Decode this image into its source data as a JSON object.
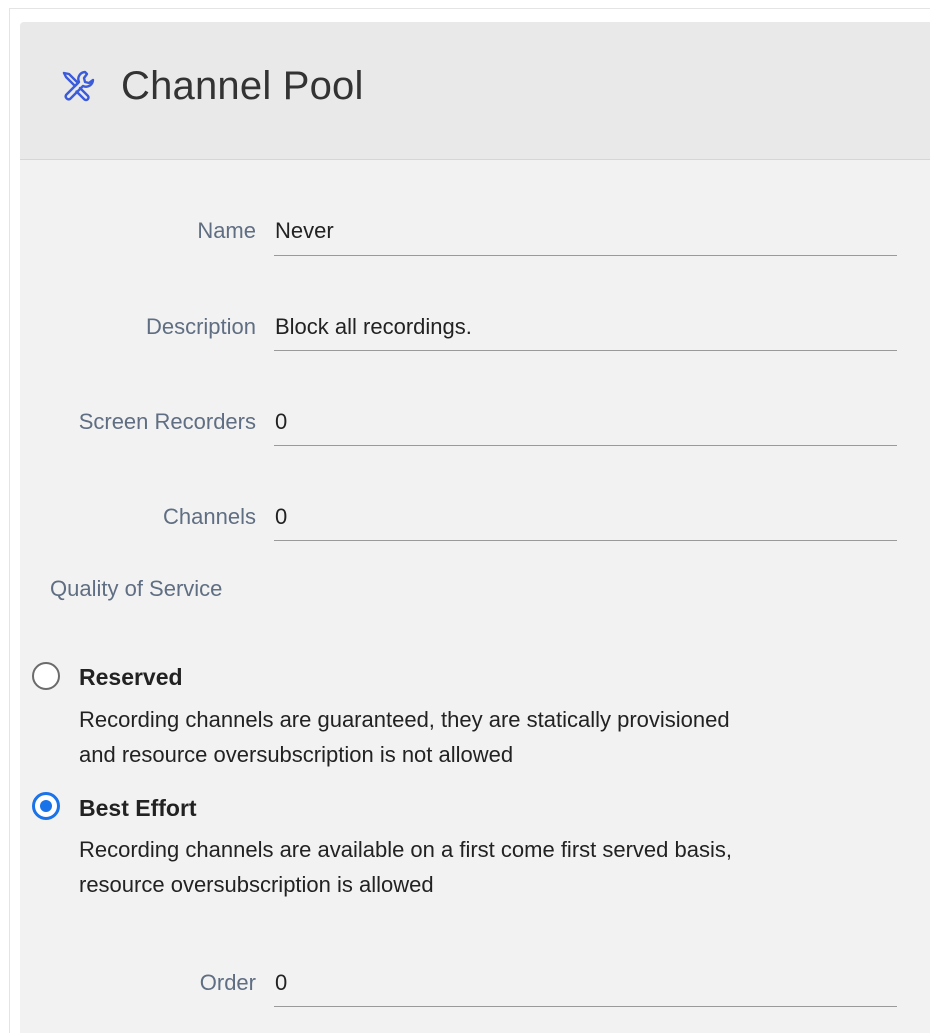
{
  "header": {
    "title": "Channel Pool",
    "icon": "tools-icon",
    "icon_color": "#3b5bdb"
  },
  "fields": {
    "name": {
      "label": "Name",
      "value": "Never"
    },
    "description": {
      "label": "Description",
      "value": "Block all recordings."
    },
    "screen_recorders": {
      "label": "Screen Recorders",
      "value": "0"
    },
    "channels": {
      "label": "Channels",
      "value": "0"
    },
    "order": {
      "label": "Order",
      "value": "0"
    }
  },
  "qos": {
    "label": "Quality of Service",
    "selected": "best_effort",
    "options": [
      {
        "id": "reserved",
        "title": "Reserved",
        "desc_line1": "Recording channels are guaranteed, they are statically provisioned",
        "desc_line2": "and resource oversubscription is not allowed"
      },
      {
        "id": "best_effort",
        "title": "Best Effort",
        "desc_line1": "Recording channels are available on a first come first served basis,",
        "desc_line2": "resource oversubscription is allowed"
      }
    ]
  },
  "colors": {
    "accent": "#1a73e8",
    "label": "#5f6e82",
    "header_bg": "#e9e9e9",
    "card_bg": "#f2f2f2"
  }
}
